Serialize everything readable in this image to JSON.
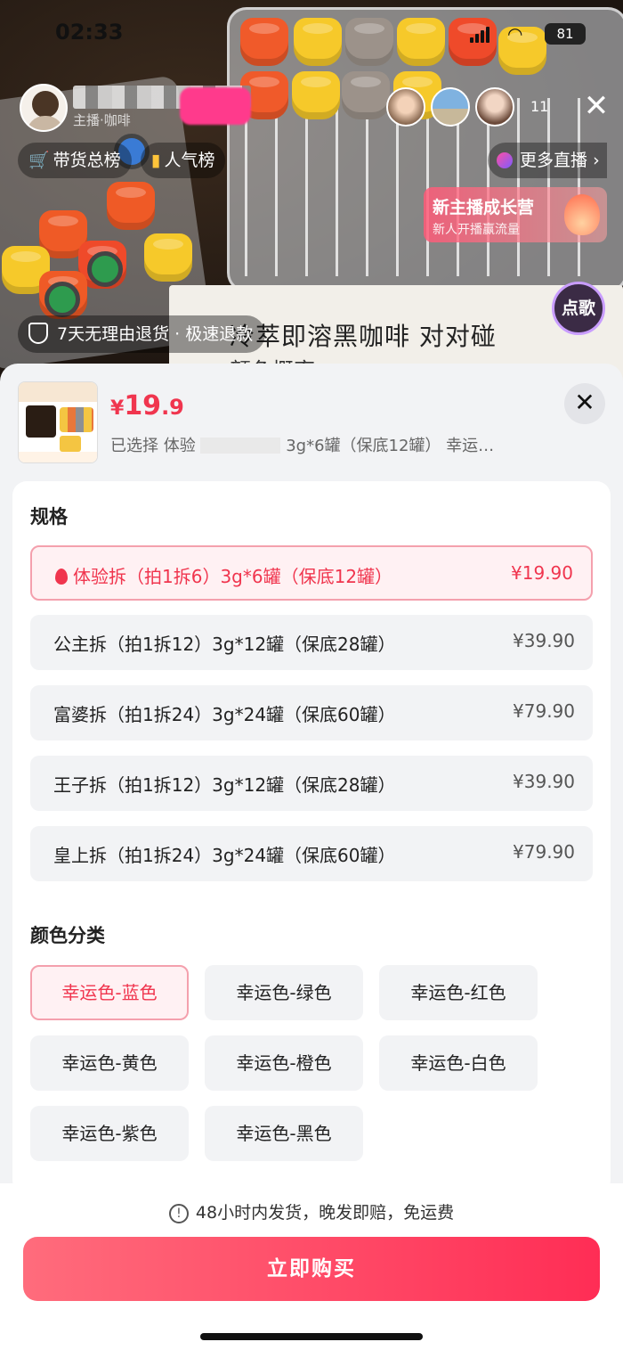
{
  "status_bar": {
    "time": "02:33",
    "battery": "81"
  },
  "live": {
    "host_sub": "主播·咖啡",
    "viewer_count": "11",
    "rank_pill": "带货总榜",
    "popularity_pill": "人气榜",
    "more_live": "更多直播",
    "promo_title": "新主播成长营",
    "promo_sub": "新人开播赢流量",
    "song_button": "点歌",
    "return_policy": "7天无理由退货 · 极速退款",
    "sign_line1": "冷萃即溶黑咖啡   对对碰",
    "sign_line2": "颜色概率"
  },
  "product": {
    "price_currency": "¥",
    "price_int": "19",
    "price_dec": ".9",
    "selected_prefix": "已选择 体验",
    "selected_suffix": "3g*6罐（保底12罐） 幸运…"
  },
  "spec_section": {
    "title": "规格",
    "items": [
      {
        "name": "体验拆（拍1拆6）3g*6罐（保底12罐）",
        "price": "¥19.90"
      },
      {
        "name": "公主拆（拍1拆12）3g*12罐（保底28罐）",
        "price": "¥39.90"
      },
      {
        "name": "富婆拆（拍1拆24）3g*24罐（保底60罐）",
        "price": "¥79.90"
      },
      {
        "name": "王子拆（拍1拆12）3g*12罐（保底28罐）",
        "price": "¥39.90"
      },
      {
        "name": "皇上拆（拍1拆24）3g*24罐（保底60罐）",
        "price": "¥79.90"
      }
    ]
  },
  "color_section": {
    "title": "颜色分类",
    "items": [
      "幸运色-蓝色",
      "幸运色-绿色",
      "幸运色-红色",
      "幸运色-黄色",
      "幸运色-橙色",
      "幸运色-白色",
      "幸运色-紫色",
      "幸运色-黑色"
    ]
  },
  "footer": {
    "shipping_note": "48小时内发货，晚发即赔，免运费",
    "buy_button": "立即购买"
  },
  "colors": {
    "accent": "#f0354e",
    "buy_gradient_start": "#ff6c7c",
    "buy_gradient_end": "#ff2d55",
    "sheet_bg": "#f2f3f5"
  }
}
